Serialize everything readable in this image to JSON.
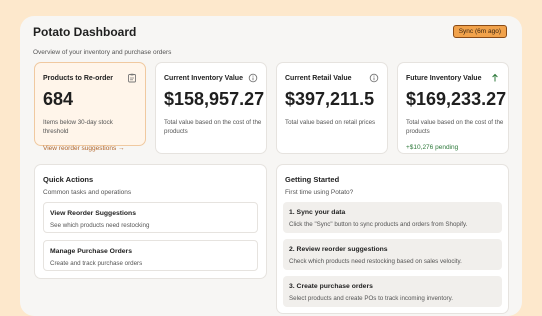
{
  "header": {
    "title": "Potato Dashboard",
    "subtitle": "Overview of your inventory and purchase orders",
    "sync_label": "Sync (6m ago)"
  },
  "stats": [
    {
      "label": "Products to Re-order",
      "value": "684",
      "desc": "Items below 30-day stock threshold",
      "link": "View reorder suggestions →",
      "icon": "clipboard-icon"
    },
    {
      "label": "Current Inventory Value",
      "value": "$158,957.27",
      "desc": "Total value based on the cost of the products",
      "icon": "info-icon"
    },
    {
      "label": "Current Retail Value",
      "value": "$397,211.5",
      "desc": "Total value based on retail prices",
      "icon": "info-icon"
    },
    {
      "label": "Future Inventory Value",
      "value": "$169,233.27",
      "desc": "Total value based on the cost of the products",
      "pending": "+$10,276 pending",
      "icon": "arrow-up-icon"
    }
  ],
  "quick_actions": {
    "title": "Quick Actions",
    "subtitle": "Common tasks and operations",
    "items": [
      {
        "title": "View Reorder Suggestions",
        "desc": "See which products need restocking"
      },
      {
        "title": "Manage Purchase Orders",
        "desc": "Create and track purchase orders"
      }
    ]
  },
  "getting_started": {
    "title": "Getting Started",
    "subtitle": "First time using Potato?",
    "steps": [
      {
        "title": "1. Sync your data",
        "desc": "Click the \"Sync\" button to sync products and orders from Shopify."
      },
      {
        "title": "2. Review reorder suggestions",
        "desc": "Check which products need restocking based on sales velocity."
      },
      {
        "title": "3. Create purchase orders",
        "desc": "Select products and create POs to track incoming inventory."
      }
    ]
  },
  "colors": {
    "background": "#fde8cc",
    "accent": "#f1a24b",
    "link": "#b2652a",
    "positive": "#2f7a3c"
  }
}
